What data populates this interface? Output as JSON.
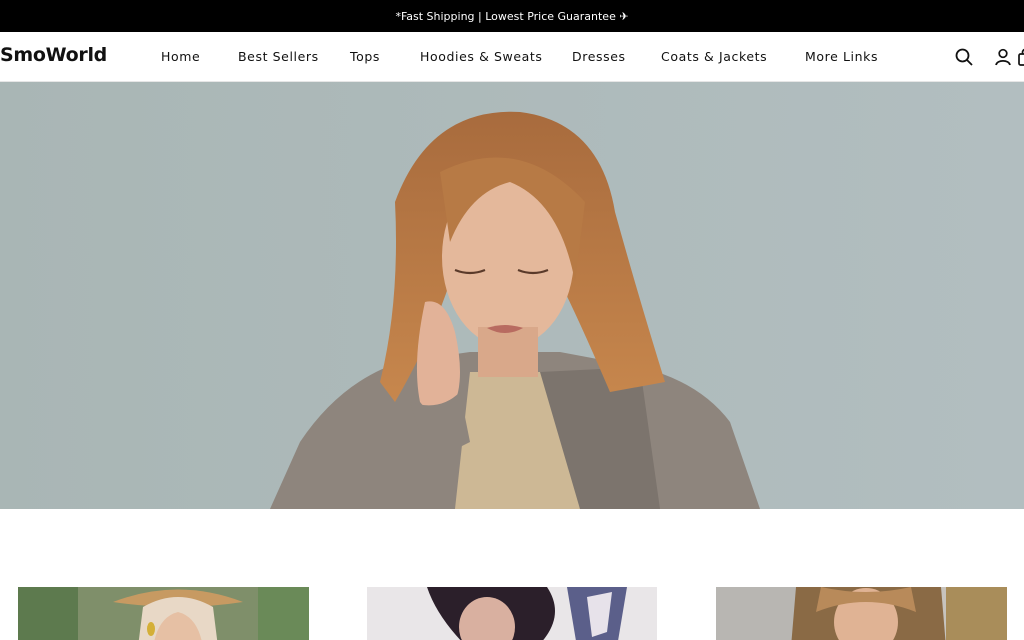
{
  "announcement": {
    "text": "*Fast Shipping | Lowest Price Guarantee ✈"
  },
  "header": {
    "logo": "SmoWorld",
    "nav": [
      {
        "label": "Home"
      },
      {
        "label": "Best Sellers"
      },
      {
        "label": "Tops"
      },
      {
        "label": "Hoodies & Sweats"
      },
      {
        "label": "Dresses"
      },
      {
        "label": "Coats & Jackets"
      },
      {
        "label": "More Links"
      }
    ],
    "icons": [
      "search-icon",
      "account-icon",
      "cart-icon"
    ]
  },
  "hero": {
    "image": "woman-in-grey-coat-looking-down",
    "background_color": "#a8b5b5"
  },
  "collections": [
    {
      "image": "woman-straw-hat-tropical"
    },
    {
      "image": "woman-dark-hair-profile"
    },
    {
      "image": "woman-fur-hood-outdoor"
    }
  ]
}
